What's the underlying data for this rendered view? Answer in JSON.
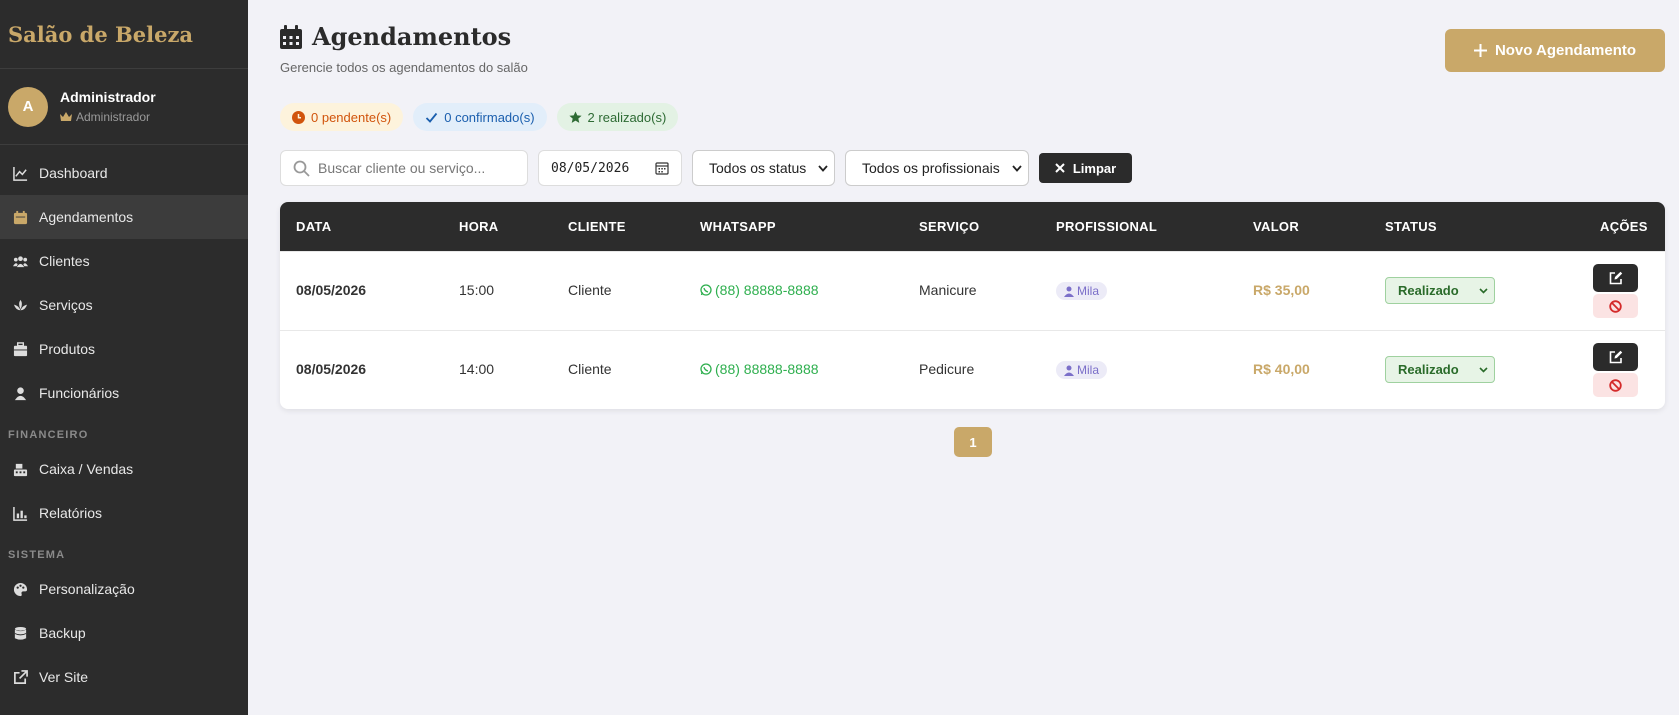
{
  "app": {
    "brand": "Salão de Beleza"
  },
  "user": {
    "initial": "A",
    "name": "Administrador",
    "role": "Administrador"
  },
  "sidebar": {
    "items": [
      {
        "label": "Dashboard",
        "icon": "chart-line-icon"
      },
      {
        "label": "Agendamentos",
        "icon": "calendar-icon",
        "active": true
      },
      {
        "label": "Clientes",
        "icon": "users-icon"
      },
      {
        "label": "Serviços",
        "icon": "spa-icon"
      },
      {
        "label": "Produtos",
        "icon": "box-icon"
      },
      {
        "label": "Funcionários",
        "icon": "user-icon"
      }
    ],
    "section_financeiro": "FINANCEIRO",
    "financeiro_items": [
      {
        "label": "Caixa / Vendas",
        "icon": "cash-register-icon"
      },
      {
        "label": "Relatórios",
        "icon": "chart-bar-icon"
      }
    ],
    "section_sistema": "SISTEMA",
    "sistema_items": [
      {
        "label": "Personalização",
        "icon": "palette-icon"
      },
      {
        "label": "Backup",
        "icon": "database-icon"
      },
      {
        "label": "Ver Site",
        "icon": "external-link-icon"
      }
    ]
  },
  "header": {
    "title": "Agendamentos",
    "subtitle": "Gerencie todos os agendamentos do salão",
    "new_button": "Novo Agendamento"
  },
  "summary": {
    "pending": "0 pendente(s)",
    "confirmed": "0 confirmado(s)",
    "done": "2 realizado(s)"
  },
  "filters": {
    "search_placeholder": "Buscar cliente ou serviço...",
    "date": "08/05/2026",
    "status": "Todos os status",
    "professional": "Todos os profissionais",
    "clear": "Limpar"
  },
  "table": {
    "columns": [
      "DATA",
      "HORA",
      "CLIENTE",
      "WHATSAPP",
      "SERVIÇO",
      "PROFISSIONAL",
      "VALOR",
      "STATUS",
      "AÇÕES"
    ],
    "rows": [
      {
        "date": "08/05/2026",
        "time": "15:00",
        "client": "Cliente",
        "whatsapp": "(88) 88888-8888",
        "service": "Manicure",
        "professional": "Mila",
        "value": "R$ 35,00",
        "status": "Realizado"
      },
      {
        "date": "08/05/2026",
        "time": "14:00",
        "client": "Cliente",
        "whatsapp": "(88) 88888-8888",
        "service": "Pedicure",
        "professional": "Mila",
        "value": "R$ 40,00",
        "status": "Realizado"
      }
    ]
  },
  "pagination": {
    "current": "1"
  },
  "colors": {
    "accent": "#c9a869",
    "sidebar_bg": "#2c2c2c",
    "whatsapp": "#2eaf4e",
    "status_green": "#2a6b2a"
  }
}
